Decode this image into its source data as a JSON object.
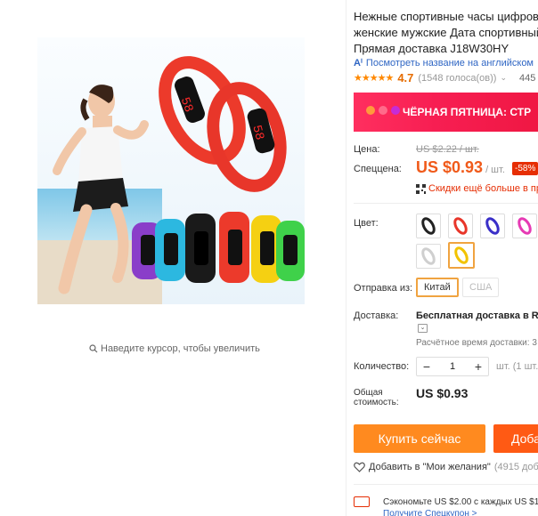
{
  "product": {
    "title_line1": "Нежные спортивные часы цифрово",
    "title_line2": "женские мужские Дата спортивный",
    "title_line3": "Прямая доставка J18W30HY"
  },
  "translate_link": "Посмотреть название на английском",
  "rating": {
    "stars": "★★★★★",
    "value": "4.7",
    "count": "(1548 голоса(ов))",
    "orders": "445"
  },
  "banner": {
    "text": "ЧЁРНАЯ ПЯТНИЦА: СТР"
  },
  "price": {
    "label": "Цена:",
    "old": "US $2.22 / шт.",
    "sale_label": "Спеццена:",
    "sale": "US $0.93",
    "unit": "/ шт.",
    "discount": "-58%",
    "coupon_text": "Скидки ещё больше в при"
  },
  "color": {
    "label": "Цвет:",
    "options": [
      "black",
      "red",
      "blue",
      "pink",
      "white",
      "yellow"
    ],
    "selected": "yellow"
  },
  "shipping_from": {
    "label": "Отправка из:",
    "options": [
      "Китай",
      "США"
    ],
    "selected": "Китай"
  },
  "delivery": {
    "label": "Доставка:",
    "value": "Бесплатная доставка в Rus",
    "time": "Расчётное время доставки: 3"
  },
  "quantity": {
    "label": "Количество:",
    "minus": "−",
    "value": "1",
    "plus": "+",
    "unit": "шт. (1 шт."
  },
  "total": {
    "label": "Общая стоимость:",
    "value": "US $0.93"
  },
  "actions": {
    "buy": "Купить сейчас",
    "cart": "Доба"
  },
  "wishlist": {
    "text": "Добавить в \"Мои желания\"",
    "count": "(4915 доба"
  },
  "promo": {
    "line1": "Сэкономьте US $2.00 с каждых US $1",
    "line2": "Получите Спецкупон >"
  },
  "zoom_hint": "Наведите курсор, чтобы увеличить",
  "colors": {
    "accent_orange": "#ff8a1f",
    "cart_orange": "#ff5a14",
    "price_red": "#f05a1a",
    "discount_red": "#e62e04",
    "link_blue": "#2f66c4",
    "select_border": "#f0a340"
  }
}
